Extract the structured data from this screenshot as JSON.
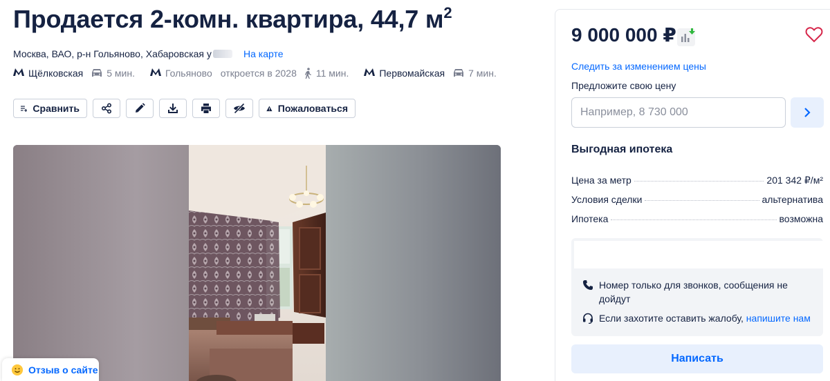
{
  "listing": {
    "title": "Продается 2-комн. квартира, 44,7 м",
    "title_sup": "2",
    "address": "Москва, ВАО, р-н Гольяново, Хабаровская у",
    "map_link": "На карте"
  },
  "metro": [
    {
      "station": "Щёлковская",
      "transport": "car",
      "time": "5 мин.",
      "opens": ""
    },
    {
      "station": "Гольяново",
      "transport": "walk",
      "time": "11 мин.",
      "opens": "откроется в 2028"
    },
    {
      "station": "Первомайская",
      "transport": "car",
      "time": "7 мин.",
      "opens": ""
    }
  ],
  "actions": {
    "compare": "Сравнить",
    "complain": "Пожаловаться",
    "icons": [
      "share-icon",
      "edit-icon",
      "download-icon",
      "print-icon",
      "hide-icon",
      "warning-icon"
    ]
  },
  "feedback": {
    "label": "Отзыв о сайте"
  },
  "sidebar": {
    "price": "9 000 000 ₽",
    "follow_price": "Следить за изменением цены",
    "offer_label": "Предложите свою цену",
    "offer_placeholder": "Например, 8 730 000",
    "mortgage_title": "Выгодная ипотека",
    "facts": [
      {
        "key": "Цена за метр",
        "value": "201 342 ₽/м²"
      },
      {
        "key": "Условия сделки",
        "value": "альтернатива"
      },
      {
        "key": "Ипотека",
        "value": "возможна"
      }
    ],
    "notice_calls": "Номер только для звонков, сообщения не дойдут",
    "notice_complaint": "Если захотите оставить жалобу,",
    "notice_complaint_link": "напишите нам",
    "write_button": "Написать"
  },
  "colors": {
    "text": "#152242",
    "link": "#0468ff",
    "secondary": "#7a7f8f",
    "button_light": "#e8f0fd",
    "price_down_arrow": "#2fb83d"
  }
}
